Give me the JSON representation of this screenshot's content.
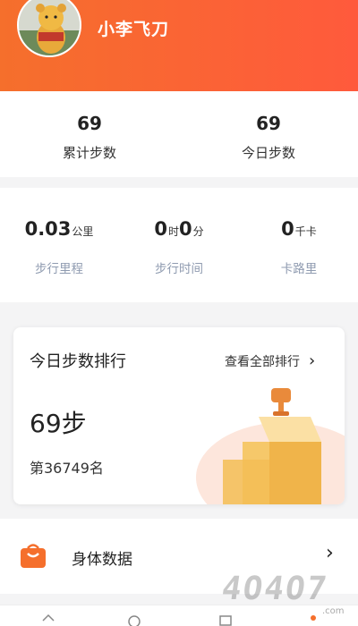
{
  "profile": {
    "username": "小李飞刀"
  },
  "steps": {
    "total": "69",
    "total_label": "累计步数",
    "today": "69",
    "today_label": "今日步数"
  },
  "metrics": [
    {
      "value": "0.03",
      "unit": "公里",
      "label": "步行里程"
    },
    {
      "value": "0",
      "unit": "时",
      "value2": "0",
      "unit2": "分",
      "label": "步行时间"
    },
    {
      "value": "0",
      "unit": "千卡",
      "label": "卡路里"
    }
  ],
  "ranking": {
    "title": "今日步数排行",
    "link": "查看全部排行",
    "steps": "69步",
    "position": "第36749名"
  },
  "body_data": {
    "label": "身体数据"
  },
  "watermark": {
    "text": "4O4O7",
    "small": ".com"
  },
  "colors": {
    "header": "#f56f2c",
    "accent": "#ff5a3c",
    "metric_label": "#8f9bb0",
    "trophy": "#f6c86a"
  }
}
